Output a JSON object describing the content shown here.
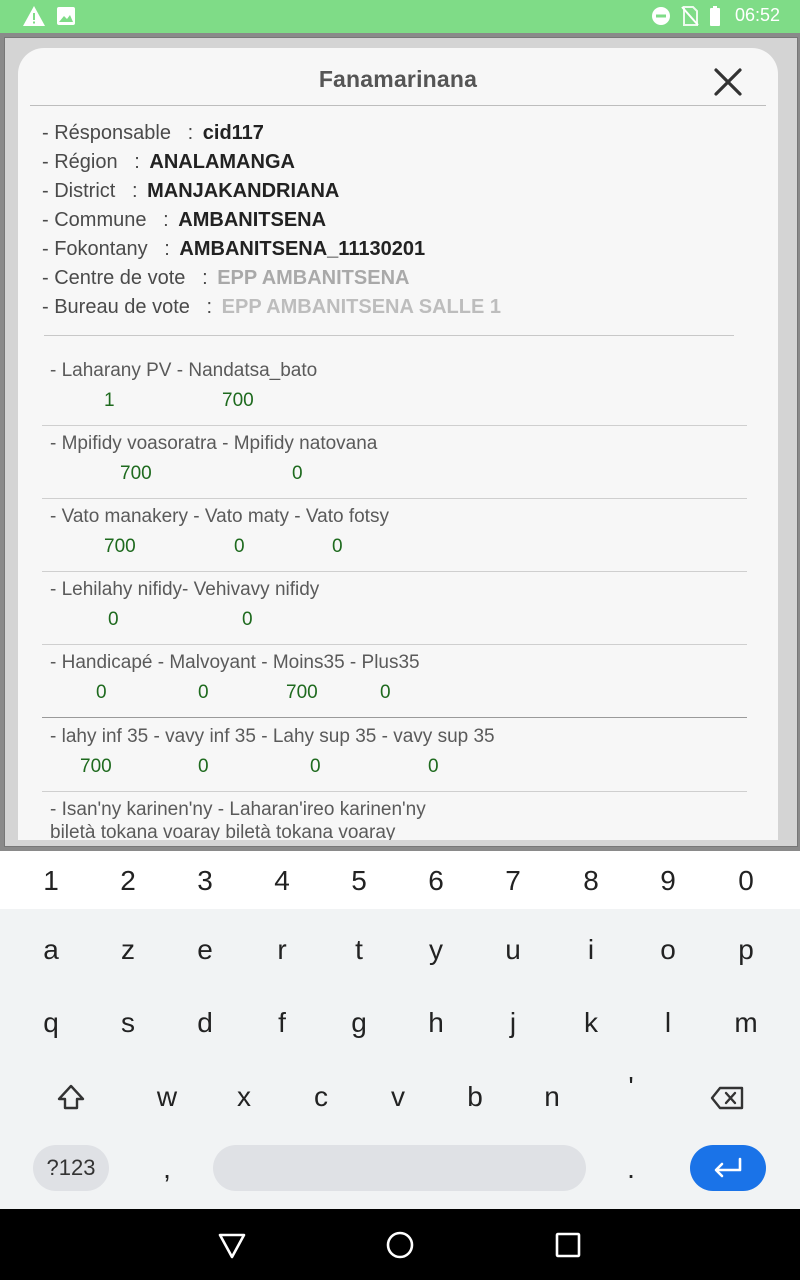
{
  "status_bar": {
    "time": "06:52",
    "left_icons": [
      "warning-icon",
      "image-icon"
    ],
    "right_icons": [
      "dnd-icon",
      "no-sim-icon",
      "battery-icon"
    ],
    "color": "#7fdc87"
  },
  "dialog": {
    "title": "Fanamarinana",
    "close_icon": "close-icon",
    "info": [
      {
        "label": "- Résponsable",
        "sep": ":",
        "value": "cid117"
      },
      {
        "label": "- Région",
        "sep": ":",
        "value": "ANALAMANGA"
      },
      {
        "label": "- District",
        "sep": ":",
        "value": "MANJAKANDRIANA"
      },
      {
        "label": "- Commune",
        "sep": ":",
        "value": "AMBANITSENA"
      },
      {
        "label": "- Fokontany",
        "sep": ":",
        "value": "AMBANITSENA_11130201"
      },
      {
        "label": "- Centre de vote",
        "sep": ":",
        "value": "EPP AMBANITSENA"
      },
      {
        "label": "- Bureau de vote",
        "sep": ":",
        "value": "EPP AMBANITSENA SALLE 1"
      }
    ],
    "sections": [
      {
        "label": "- Laharany PV - Nandatsa_bato",
        "values": [
          "1",
          "700"
        ]
      },
      {
        "label": "- Mpifidy voasoratra - Mpifidy natovana",
        "values": [
          "700",
          "0"
        ]
      },
      {
        "label": "- Vato manakery - Vato maty - Vato fotsy",
        "values": [
          "700",
          "0",
          "0"
        ]
      },
      {
        "label": "- Lehilahy nifidy- Vehivavy nifidy",
        "values": [
          "0",
          "0"
        ]
      },
      {
        "label": "- Handicapé - Malvoyant  - Moins35  - Plus35",
        "values": [
          "0",
          "0",
          "700",
          "0"
        ]
      },
      {
        "label": "- lahy inf 35 - vavy inf 35  - Lahy sup 35  - vavy sup 35",
        "values": [
          "700",
          "0",
          "0",
          "0"
        ]
      },
      {
        "label": "- Isan'ny karinen'ny    - Laharan'ireo karinen'ny",
        "label2": "biletà tokana voaray  biletà tokana voaray",
        "values": []
      }
    ],
    "value_color": "#1e6a1e"
  },
  "keyboard": {
    "numbers": [
      "1",
      "2",
      "3",
      "4",
      "5",
      "6",
      "7",
      "8",
      "9",
      "0"
    ],
    "row1": [
      "a",
      "z",
      "e",
      "r",
      "t",
      "y",
      "u",
      "i",
      "o",
      "p"
    ],
    "row2": [
      "q",
      "s",
      "d",
      "f",
      "g",
      "h",
      "j",
      "k",
      "l",
      "m"
    ],
    "row3": [
      "w",
      "x",
      "c",
      "v",
      "b",
      "n",
      "'"
    ],
    "symbols_label": "?123",
    "comma": ",",
    "period": ".",
    "shift_icon": "shift-icon",
    "backspace_icon": "backspace-icon",
    "enter_icon": "enter-icon",
    "enter_color": "#1a73e8"
  },
  "nav_bar": {
    "buttons": [
      "back-icon",
      "home-icon",
      "recents-icon"
    ]
  }
}
